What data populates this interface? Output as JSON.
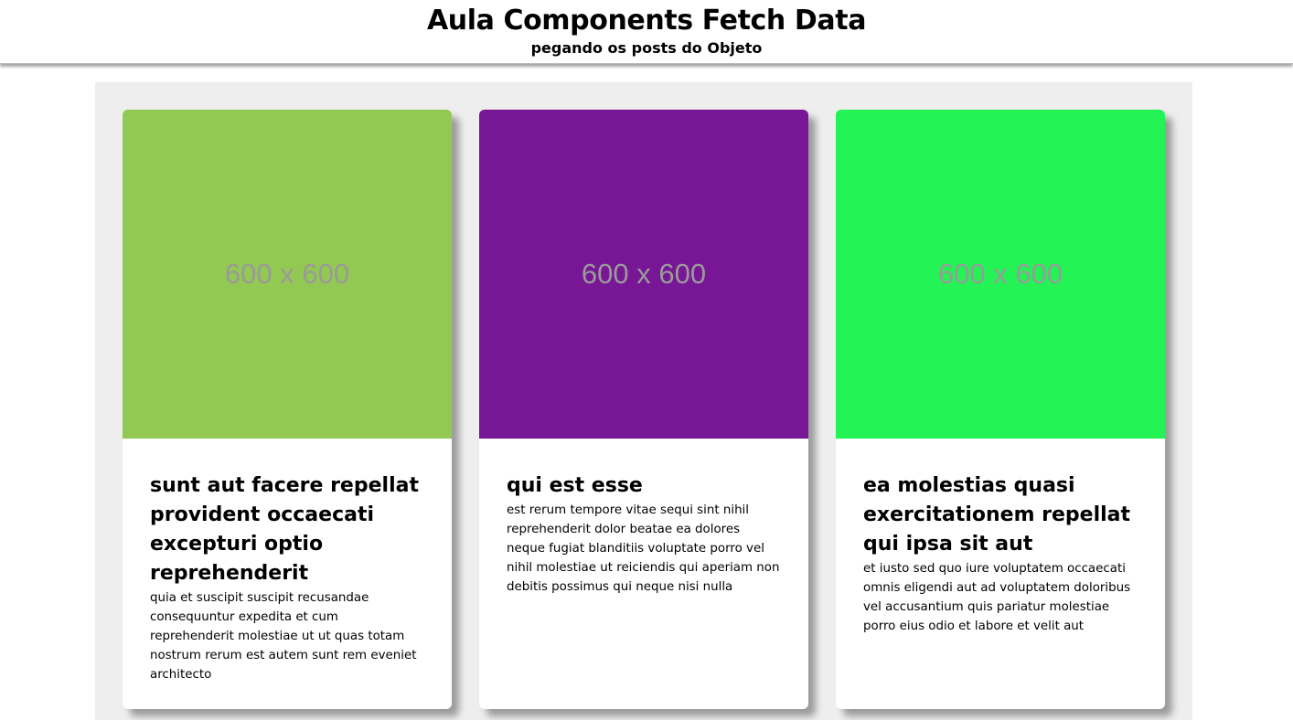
{
  "header": {
    "title": "Aula Components Fetch Data",
    "subtitle": "pegando os posts do Objeto"
  },
  "posts": [
    {
      "image_text": "600 x 600",
      "image_color": "#92c952",
      "title": "sunt aut facere repellat provident occaecati excepturi optio reprehenderit",
      "body": "quia et suscipit suscipit recusandae consequuntur expedita et cum reprehenderit molestiae ut ut quas totam nostrum rerum est autem sunt rem eveniet architecto"
    },
    {
      "image_text": "600 x 600",
      "image_color": "#771796",
      "title": "qui est esse",
      "body": "est rerum tempore vitae sequi sint nihil reprehenderit dolor beatae ea dolores neque fugiat blanditiis voluptate porro vel nihil molestiae ut reiciendis qui aperiam non debitis possimus qui neque nisi nulla"
    },
    {
      "image_text": "600 x 600",
      "image_color": "#24f355",
      "title": "ea molestias quasi exercitationem repellat qui ipsa sit aut",
      "body": "et iusto sed quo iure voluptatem occaecati omnis eligendi aut ad voluptatem doloribus vel accusantium quis pariatur molestiae porro eius odio et labore et velit aut"
    }
  ]
}
